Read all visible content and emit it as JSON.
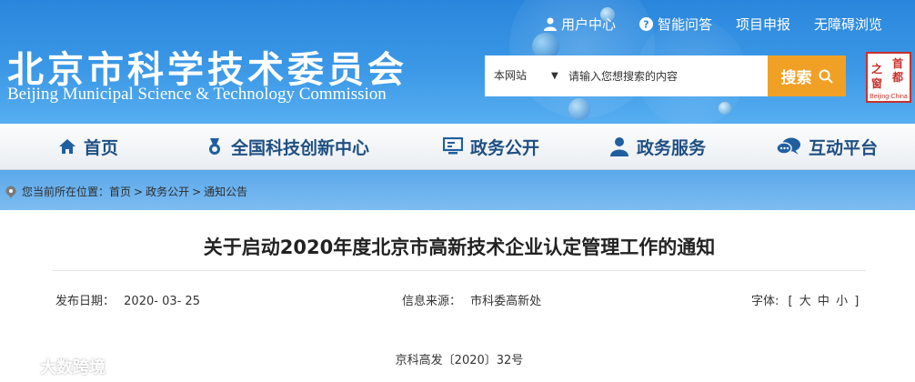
{
  "header": {
    "title_cn": "北京市科学技术委员会",
    "title_en": "Beijing Municipal Science & Technology Commission",
    "top_links": [
      {
        "label": "用户中心",
        "icon": "user-icon"
      },
      {
        "label": "智能问答",
        "icon": "question-icon"
      },
      {
        "label": "项目申报"
      },
      {
        "label": "无障碍浏览"
      }
    ],
    "search": {
      "scope": "本网站",
      "placeholder": "请输入您想搜索的内容",
      "button": "搜索"
    },
    "badge": {
      "chars": [
        "首",
        "都",
        "之",
        "窗"
      ],
      "tag": "Beijing-China"
    }
  },
  "nav": [
    {
      "label": "首页",
      "icon": "home-icon"
    },
    {
      "label": "全国科技创新中心",
      "icon": "medal-icon"
    },
    {
      "label": "政务公开",
      "icon": "monitor-icon"
    },
    {
      "label": "政务服务",
      "icon": "person-icon"
    },
    {
      "label": "互动平台",
      "icon": "chat-icon"
    }
  ],
  "breadcrumb": {
    "prefix": "您当前所在位置：",
    "items": [
      "首页",
      "政务公开",
      "通知公告"
    ],
    "separator": ">"
  },
  "article": {
    "title": "关于启动2020年度北京市高新技术企业认定管理工作的通知",
    "date_label": "发布日期：",
    "date": "2020- 03- 25",
    "source_label": "信息来源：",
    "source": "市科委高新处",
    "font_label": "字体:",
    "font_sizes": [
      "大",
      "中",
      "小"
    ],
    "doc_no": "京科高发〔2020〕32号"
  },
  "watermark": "大数跨境",
  "colors": {
    "header_blue": "#2a86dc",
    "nav_text": "#1f4f82",
    "search_button": "#f0a025",
    "badge_red": "#c9302c"
  }
}
